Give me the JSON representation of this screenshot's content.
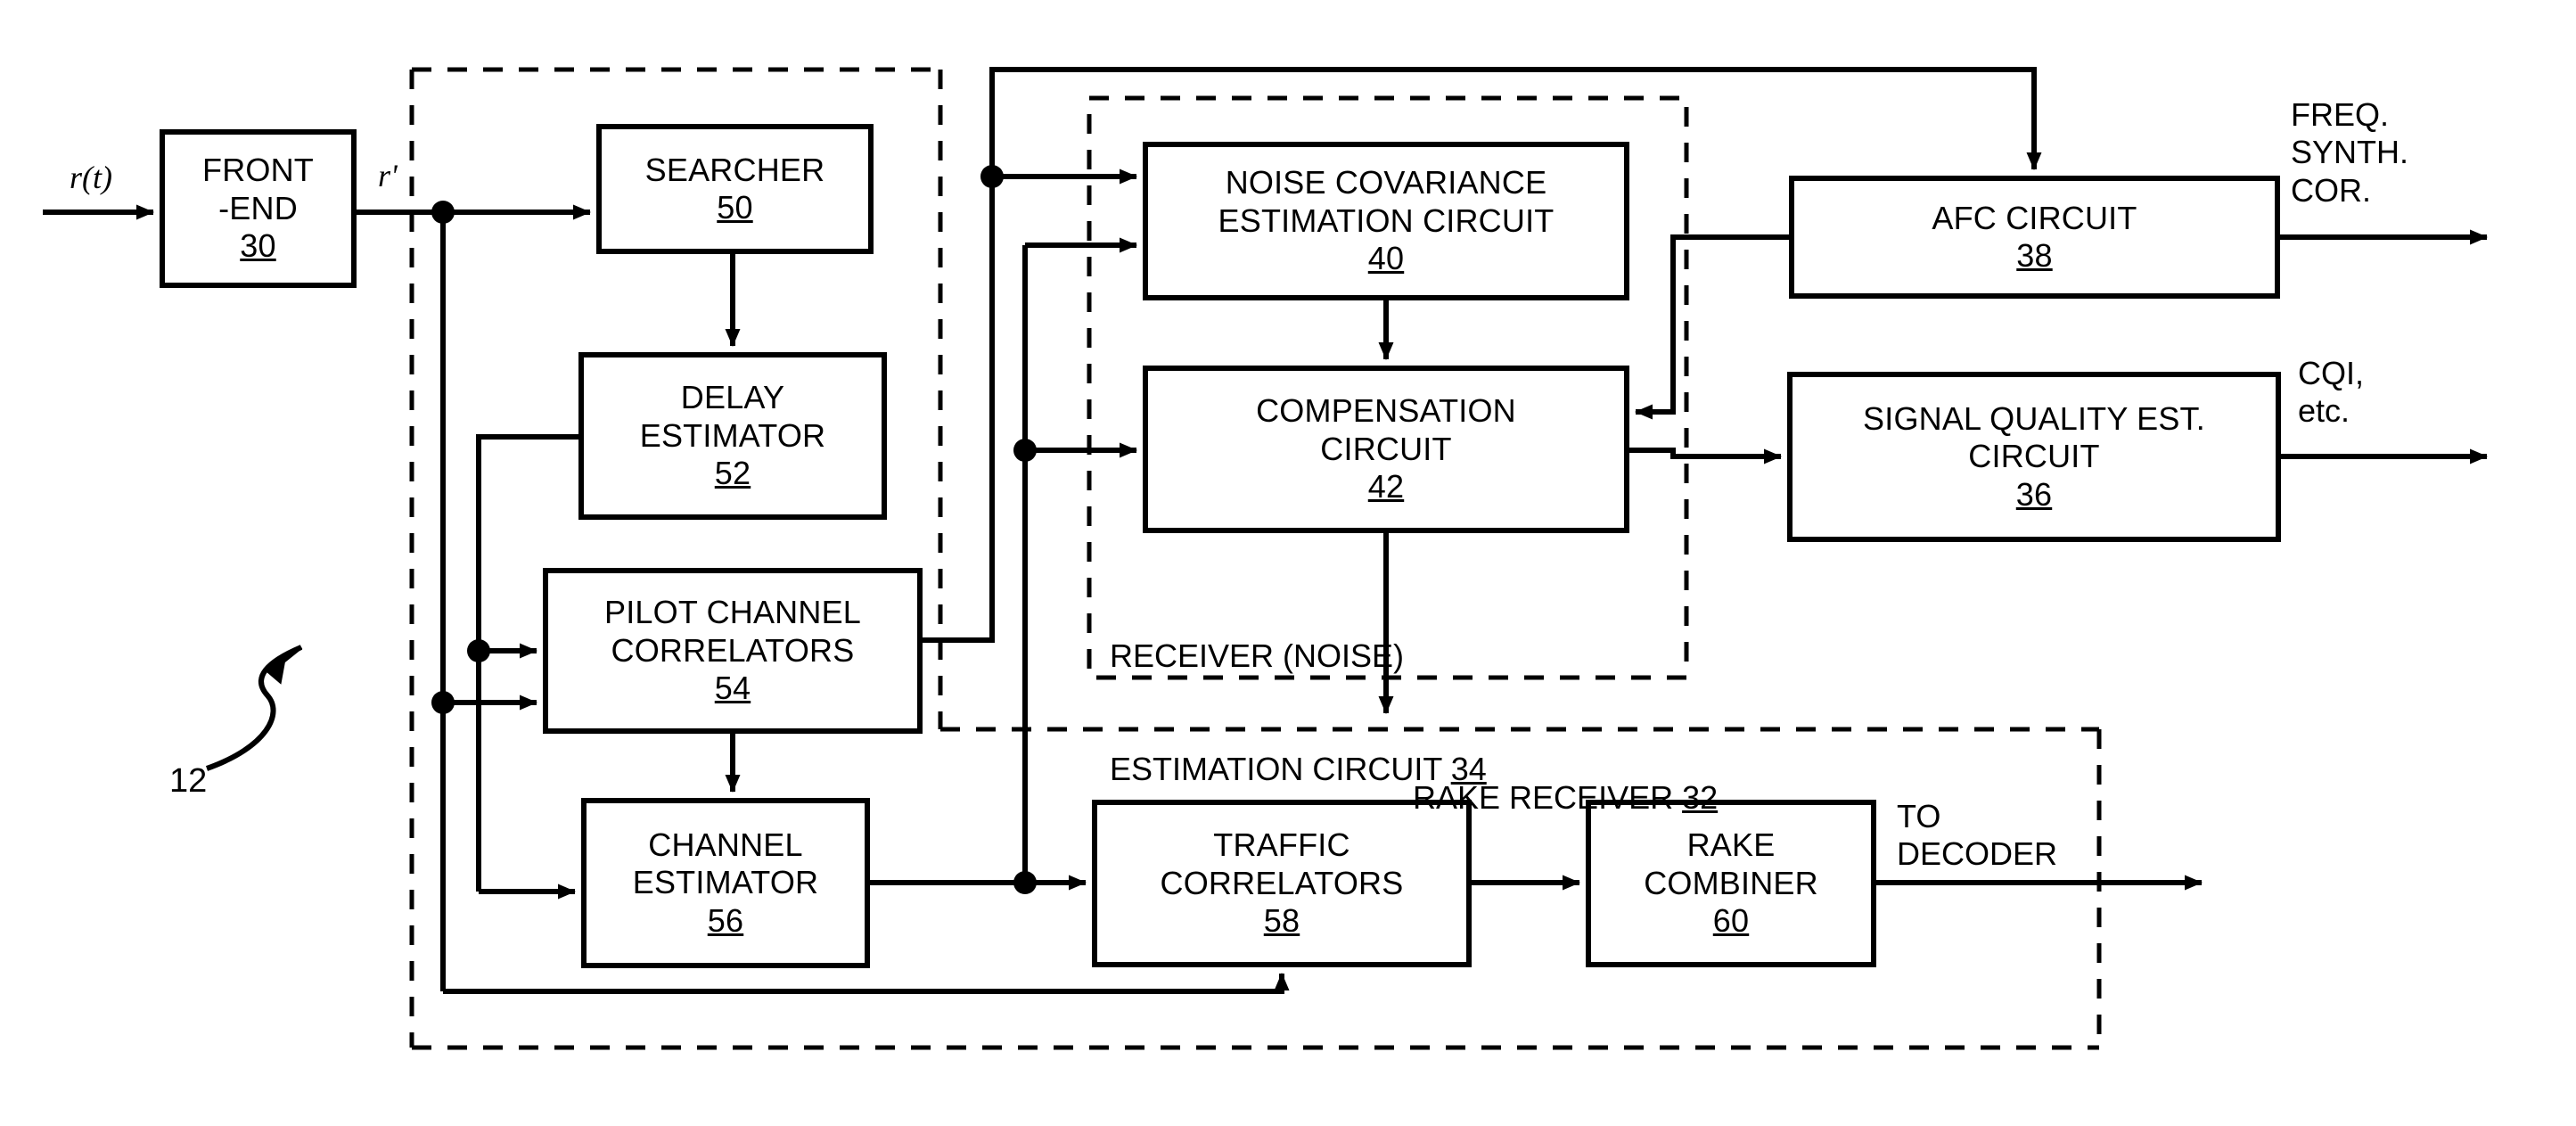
{
  "figure": {
    "type": "block-diagram",
    "reference_numeral": "12",
    "signals": {
      "input": "r(t)",
      "intermediate": "r'"
    }
  },
  "blocks": [
    {
      "id": "front-end",
      "lines": [
        "FRONT",
        "-END"
      ],
      "ref": "30"
    },
    {
      "id": "searcher",
      "lines": [
        "SEARCHER"
      ],
      "ref": "50"
    },
    {
      "id": "delay-estimator",
      "lines": [
        "DELAY",
        "ESTIMATOR"
      ],
      "ref": "52"
    },
    {
      "id": "pilot-channel-correlators",
      "lines": [
        "PILOT CHANNEL",
        "CORRELATORS"
      ],
      "ref": "54"
    },
    {
      "id": "channel-estimator",
      "lines": [
        "CHANNEL",
        "ESTIMATOR"
      ],
      "ref": "56"
    },
    {
      "id": "noise-covariance-estimation-circuit",
      "lines": [
        "NOISE COVARIANCE",
        "ESTIMATION CIRCUIT"
      ],
      "ref": "40"
    },
    {
      "id": "compensation-circuit",
      "lines": [
        "COMPENSATION",
        "CIRCUIT"
      ],
      "ref": "42"
    },
    {
      "id": "afc-circuit",
      "lines": [
        "AFC CIRCUIT"
      ],
      "ref": "38"
    },
    {
      "id": "signal-quality-est-circuit",
      "lines": [
        "SIGNAL QUALITY EST.",
        "CIRCUIT"
      ],
      "ref": "36"
    },
    {
      "id": "traffic-correlators",
      "lines": [
        "TRAFFIC",
        "CORRELATORS"
      ],
      "ref": "58"
    },
    {
      "id": "rake-combiner",
      "lines": [
        "RAKE",
        "COMBINER"
      ],
      "ref": "60"
    }
  ],
  "groups": [
    {
      "id": "receiver-noise-estimation-circuit",
      "line1": "RECEIVER (NOISE)",
      "line2": "ESTIMATION CIRCUIT ",
      "ref": "34"
    },
    {
      "id": "rake-receiver",
      "line1": "RAKE RECEIVER ",
      "ref": "32"
    }
  ],
  "annotations": {
    "input_signal": "r(t)",
    "intermediate_signal": "r'",
    "freq_synth_cor": "FREQ.\nSYNTH.\nCOR.",
    "cqi_etc": "CQI,\netc.",
    "to_decoder": "TO\nDECODER",
    "figure_ref": "12"
  },
  "colors": {
    "stroke": "#000000",
    "background": "#ffffff"
  }
}
